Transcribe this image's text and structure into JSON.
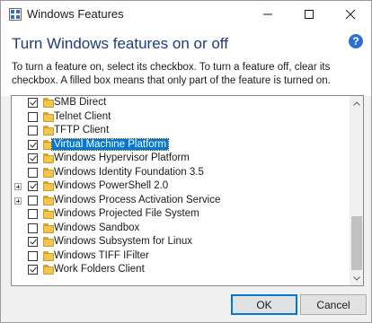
{
  "window": {
    "title": "Windows Features",
    "heading": "Turn Windows features on or off",
    "description": "To turn a feature on, select its checkbox. To turn a feature off, clear its checkbox. A filled box means that only part of the feature is turned on."
  },
  "features": [
    {
      "label": "SMB Direct",
      "checked": true,
      "expandable": false,
      "selected": false
    },
    {
      "label": "Telnet Client",
      "checked": false,
      "expandable": false,
      "selected": false
    },
    {
      "label": "TFTP Client",
      "checked": false,
      "expandable": false,
      "selected": false
    },
    {
      "label": "Virtual Machine Platform",
      "checked": true,
      "expandable": false,
      "selected": true
    },
    {
      "label": "Windows Hypervisor Platform",
      "checked": true,
      "expandable": false,
      "selected": false
    },
    {
      "label": "Windows Identity Foundation 3.5",
      "checked": false,
      "expandable": false,
      "selected": false
    },
    {
      "label": "Windows PowerShell 2.0",
      "checked": true,
      "expandable": true,
      "selected": false
    },
    {
      "label": "Windows Process Activation Service",
      "checked": false,
      "expandable": true,
      "selected": false
    },
    {
      "label": "Windows Projected File System",
      "checked": false,
      "expandable": false,
      "selected": false
    },
    {
      "label": "Windows Sandbox",
      "checked": false,
      "expandable": false,
      "selected": false
    },
    {
      "label": "Windows Subsystem for Linux",
      "checked": true,
      "expandable": false,
      "selected": false
    },
    {
      "label": "Windows TIFF IFilter",
      "checked": false,
      "expandable": false,
      "selected": false
    },
    {
      "label": "Work Folders Client",
      "checked": true,
      "expandable": false,
      "selected": false
    }
  ],
  "buttons": {
    "ok": "OK",
    "cancel": "Cancel"
  },
  "icons": {
    "app": "windows-features-icon",
    "help": "help-icon",
    "help_glyph": "?"
  },
  "colors": {
    "heading": "#1e3c78",
    "selection": "#0078d7",
    "folder": "#f1c64c"
  }
}
